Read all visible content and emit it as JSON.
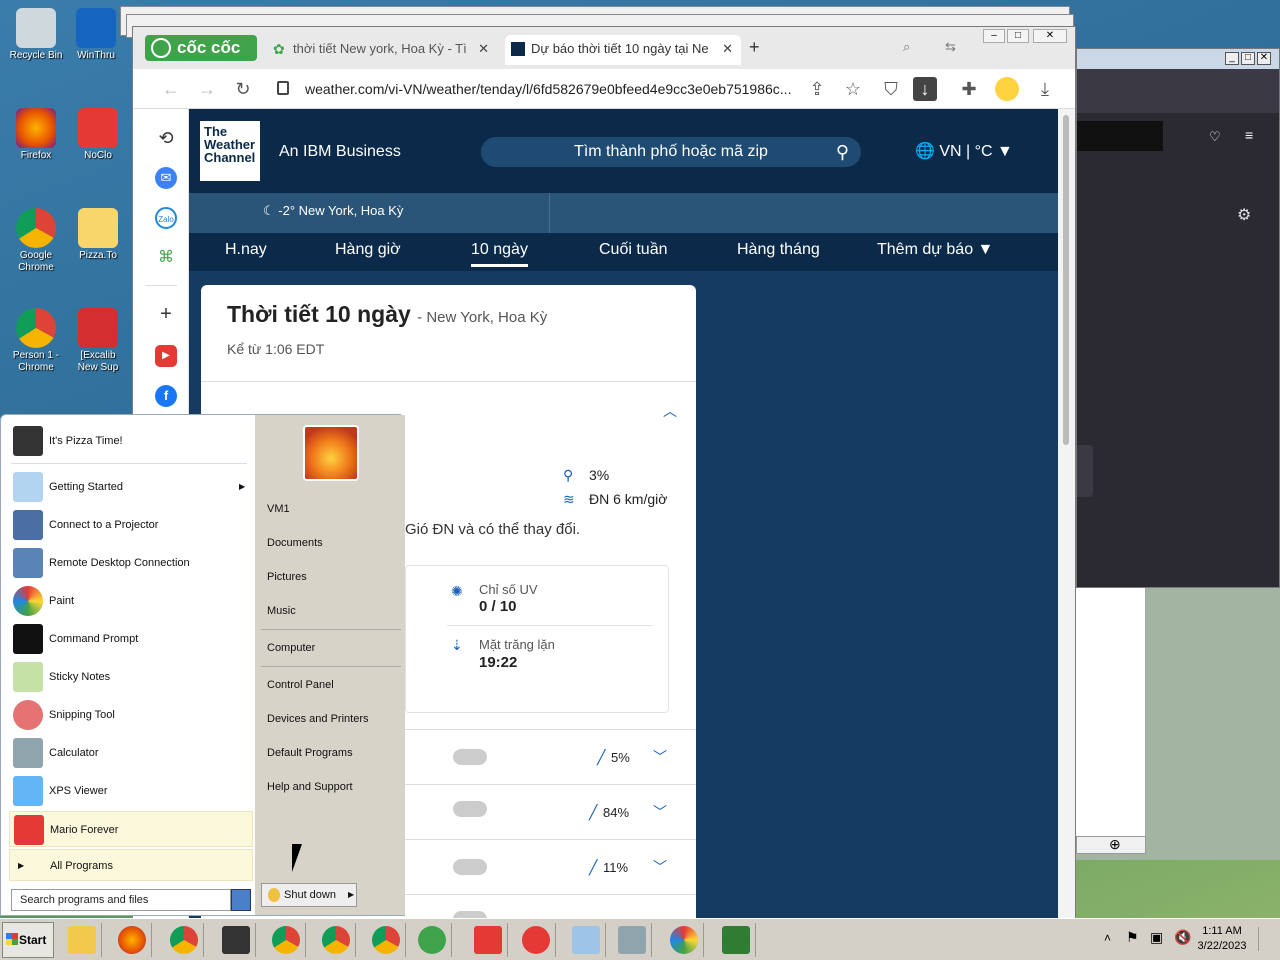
{
  "desktop": {
    "icons": [
      {
        "label": "Recycle Bin"
      },
      {
        "label": "WinThru"
      },
      {
        "label": "Firefox"
      },
      {
        "label": "NoClo"
      },
      {
        "label": "Google Chrome"
      },
      {
        "label": "Pizza.To"
      },
      {
        "label": "Person 1 - Chrome"
      },
      {
        "label": "[Excalib New Sup"
      }
    ]
  },
  "browser": {
    "brand": "cốc cốc",
    "tabs": [
      {
        "title": "thời tiết New york, Hoa Kỳ - Tì",
        "close": "✕"
      },
      {
        "title": "Dự báo thời tiết 10 ngày tại Ne",
        "close": "✕"
      }
    ],
    "new_tab": "+",
    "url": "weather.com/vi-VN/weather/tenday/l/6fd582679e0bfeed4e9cc3e0eb751986c..."
  },
  "weather": {
    "logo": "The Weather Channel",
    "tagline": "An IBM Business",
    "search_placeholder": "Tìm thành phố hoặc mã zip",
    "country": "VN",
    "unit": "°C",
    "current": "-2° New York, Hoa Kỳ",
    "nav": [
      "H.nay",
      "Hàng giờ",
      "10 ngày",
      "Cuối tuần",
      "Hàng tháng",
      "Thêm dự báo"
    ],
    "title": "Thời tiết 10 ngày",
    "location": "- New York, Hoa Kỳ",
    "as_of": "Kể từ 1:06 EDT",
    "precip": "3%",
    "wind": "ĐN 6 km/giờ",
    "wind_desc": "Gió ĐN và có thể thay đổi.",
    "uv_label": "Chỉ số UV",
    "uv_value": "0 / 10",
    "moonset_label": "Mặt trăng lặn",
    "moonset_value": "19:22",
    "rows": [
      {
        "precip": "5%"
      },
      {
        "precip": "84%"
      },
      {
        "precip": "11%"
      }
    ]
  },
  "start_menu": {
    "pinned": [
      {
        "label": "It's Pizza Time!"
      },
      {
        "label": "Getting Started"
      },
      {
        "label": "Connect to a Projector"
      },
      {
        "label": "Remote Desktop Connection"
      },
      {
        "label": "Paint"
      },
      {
        "label": "Command Prompt"
      },
      {
        "label": "Sticky Notes"
      },
      {
        "label": "Snipping Tool"
      },
      {
        "label": "Calculator"
      },
      {
        "label": "XPS Viewer"
      },
      {
        "label": "Mario Forever"
      }
    ],
    "all_programs": "All Programs",
    "search_placeholder": "Search programs and files",
    "right": [
      "VM1",
      "Documents",
      "Pictures",
      "Music",
      "Computer",
      "Control Panel",
      "Devices and Printers",
      "Default Programs",
      "Help and Support"
    ],
    "shutdown": "Shut down"
  },
  "taskbar": {
    "start": "Start",
    "time": "1:11 AM",
    "date": "3/22/2023"
  }
}
